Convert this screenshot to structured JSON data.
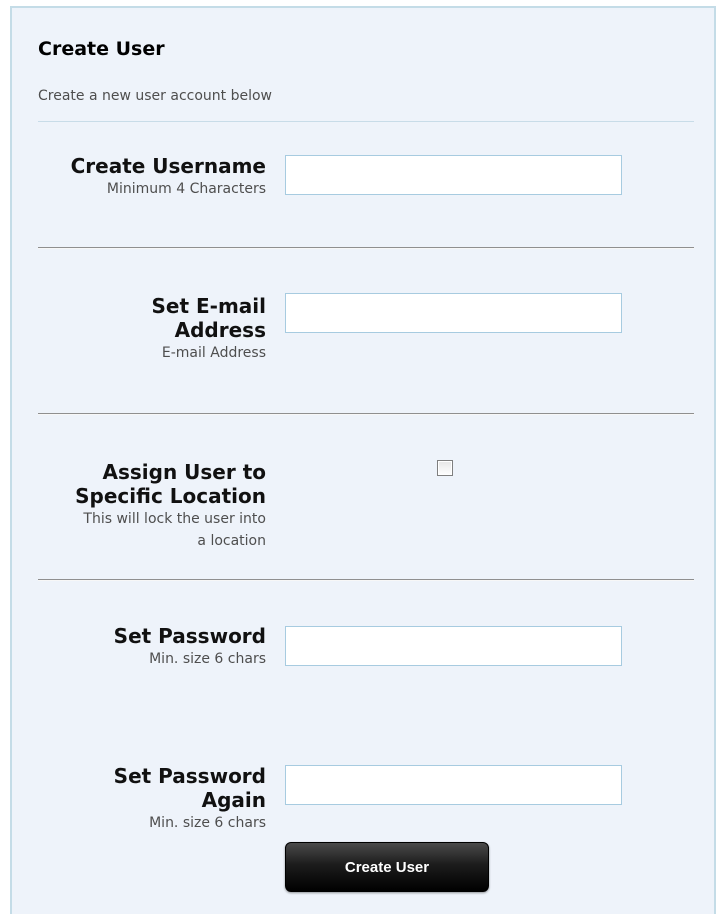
{
  "form": {
    "title": "Create User",
    "subtitle": "Create a new user account below",
    "fields": [
      {
        "label": "Create Username",
        "hint": "Minimum 4 Characters",
        "value": ""
      },
      {
        "label_line1": "Set E-mail",
        "label_line2": "Address",
        "hint": "E-mail Address",
        "value": ""
      },
      {
        "label_line1": "Assign User to",
        "label_line2": "Specific Location",
        "hint_line1": "This will lock the user into",
        "hint_line2": "a location",
        "checked": false
      },
      {
        "label": "Set Password",
        "hint": "Min. size 6 chars",
        "value": ""
      },
      {
        "label_line1": "Set Password",
        "label_line2": "Again",
        "hint": "Min. size 6 chars",
        "value": ""
      }
    ],
    "submit_label": "Create User"
  }
}
